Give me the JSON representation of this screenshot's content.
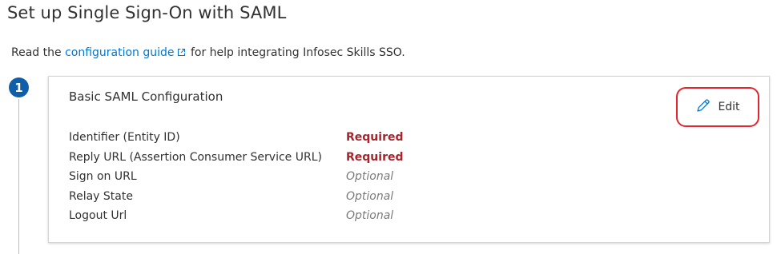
{
  "page": {
    "title": "Set up Single Sign-On with SAML"
  },
  "intro": {
    "prefix": "Read the ",
    "link_label": "configuration guide",
    "suffix": " for help integrating Infosec Skills SSO."
  },
  "step": {
    "number": "1"
  },
  "card": {
    "title": "Basic SAML Configuration",
    "edit_label": "Edit",
    "rows": [
      {
        "field": "Identifier (Entity ID)",
        "status": "Required",
        "kind": "required"
      },
      {
        "field": "Reply URL (Assertion Consumer Service URL)",
        "status": "Required",
        "kind": "required"
      },
      {
        "field": "Sign on URL",
        "status": "Optional",
        "kind": "optional"
      },
      {
        "field": "Relay State",
        "status": "Optional",
        "kind": "optional"
      },
      {
        "field": "Logout Url",
        "status": "Optional",
        "kind": "optional"
      }
    ]
  },
  "icons": {
    "link": "external-link-icon",
    "edit": "pencil-icon"
  },
  "colors": {
    "link": "#0078d4",
    "badge": "#0f5ea9",
    "required": "#a4262c",
    "optional": "#7a7a7a",
    "highlight": "#e3262d"
  }
}
